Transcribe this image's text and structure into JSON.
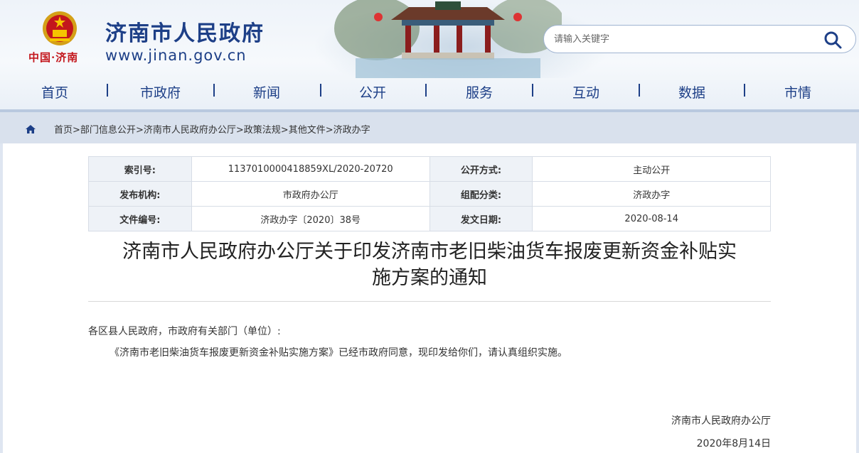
{
  "header": {
    "site_title": "济南市人民政府",
    "site_url": "www.jinan.gov.cn",
    "seal_text": "中国·济南",
    "search_placeholder": "请输入关键字",
    "colors": {
      "brand_blue": "#1d3f87",
      "seal_red": "#c3161c"
    }
  },
  "nav": {
    "items": [
      {
        "label": "首页"
      },
      {
        "label": "市政府"
      },
      {
        "label": "新闻"
      },
      {
        "label": "公开"
      },
      {
        "label": "服务"
      },
      {
        "label": "互动"
      },
      {
        "label": "数据"
      },
      {
        "label": "市情"
      }
    ]
  },
  "breadcrumb": {
    "icon": "home-icon",
    "items": [
      "首页",
      "部门信息公开",
      "济南市人民政府办公厅",
      "政策法规",
      "其他文件",
      "济政办字"
    ],
    "separator": ">"
  },
  "meta": {
    "rows": [
      {
        "k1": "索引号:",
        "v1": "1137010000418859XL/2020-20720",
        "k2": "公开方式:",
        "v2": "主动公开"
      },
      {
        "k1": "发布机构:",
        "v1": "市政府办公厅",
        "k2": "组配分类:",
        "v2": "济政办字"
      },
      {
        "k1": "文件编号:",
        "v1": "济政办字〔2020〕38号",
        "k2": "发文日期:",
        "v2": "2020-08-14"
      }
    ]
  },
  "document": {
    "title_line1": "济南市人民政府办公厅关于印发济南市老旧柴油货车报废更新资金补贴实",
    "title_line2": "施方案的通知",
    "salutation": "各区县人民政府，市政府有关部门（单位）:",
    "body": "《济南市老旧柴油货车报废更新资金补贴实施方案》已经市政府同意，现印发给你们，请认真组织实施。",
    "signature_org": "济南市人民政府办公厅",
    "signature_date": "2020年8月14日"
  }
}
